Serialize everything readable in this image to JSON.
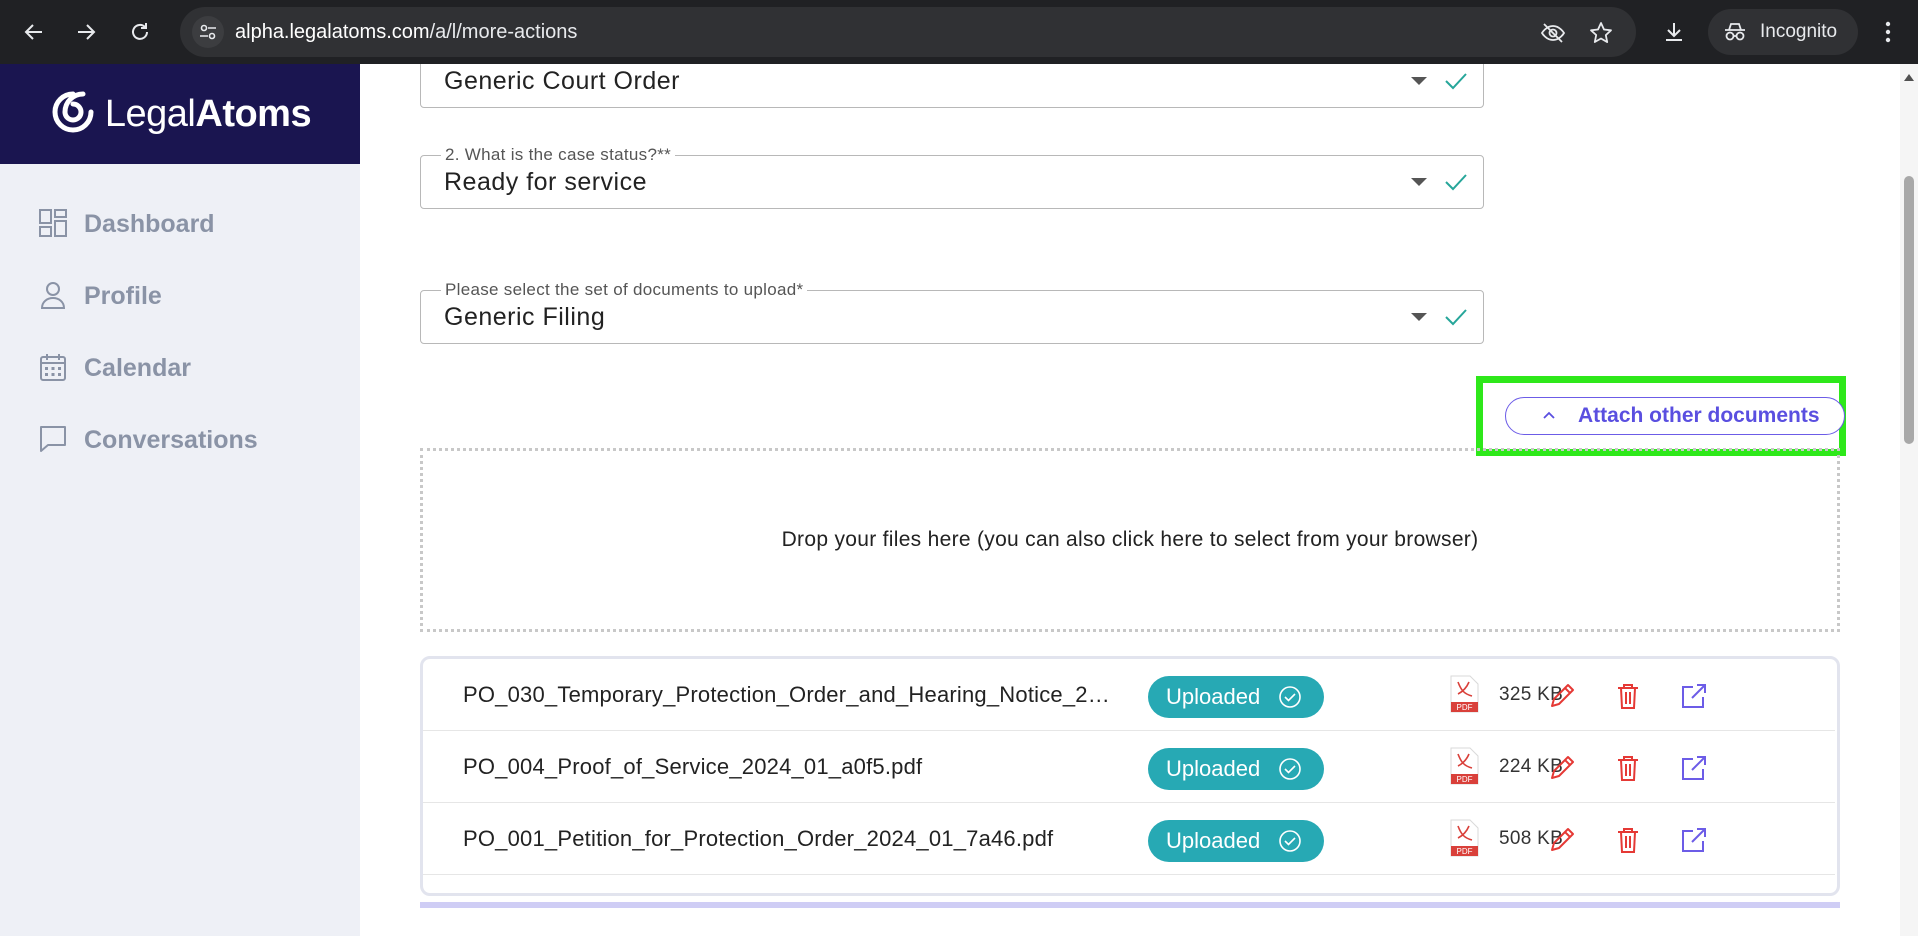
{
  "browser": {
    "url_host": "alpha.legalatoms.com",
    "url_path": "/a/l/more-actions",
    "incognito_label": "Incognito"
  },
  "brand": {
    "logo_light": "Legal",
    "logo_bold": "Atoms"
  },
  "sidebar": {
    "items": [
      {
        "label": "Dashboard",
        "icon": "dashboard-icon"
      },
      {
        "label": "Profile",
        "icon": "profile-icon"
      },
      {
        "label": "Calendar",
        "icon": "calendar-icon"
      },
      {
        "label": "Conversations",
        "icon": "chat-icon"
      }
    ]
  },
  "form": {
    "order_type": {
      "value": "Generic Court Order"
    },
    "case_status": {
      "label": "2. What is the case status?**",
      "value": "Ready for service"
    },
    "document_set": {
      "label": "Please select the set of documents to upload*",
      "value": "Generic Filing"
    }
  },
  "attach_button": {
    "label": "Attach other documents"
  },
  "dropzone": {
    "text": "Drop your files here (you can also click here to select from your browser)"
  },
  "files": [
    {
      "name": "PO_030_Temporary_Protection_Order_and_Hearing_Notice_2024_01.pdf",
      "display_name": "PO_030_Temporary_Protection_Order_and_Hearing_Notice_20...",
      "status": "Uploaded",
      "size": "325 KB"
    },
    {
      "name": "PO_004_Proof_of_Service_2024_01_a0f5.pdf",
      "display_name": "PO_004_Proof_of_Service_2024_01_a0f5.pdf",
      "status": "Uploaded",
      "size": "224 KB"
    },
    {
      "name": "PO_001_Petition_for_Protection_Order_2024_01_7a46.pdf",
      "display_name": "PO_001_Petition_for_Protection_Order_2024_01_7a46.pdf",
      "status": "Uploaded",
      "size": "508 KB"
    }
  ],
  "pdf_icon_label": "PDF",
  "colors": {
    "brand_navy": "#1a1550",
    "badge_teal": "#27a9b4",
    "action_red": "#e53935",
    "action_purple": "#6c5ce7",
    "highlight_green": "#2ee81a",
    "check_teal": "#26a69a"
  }
}
